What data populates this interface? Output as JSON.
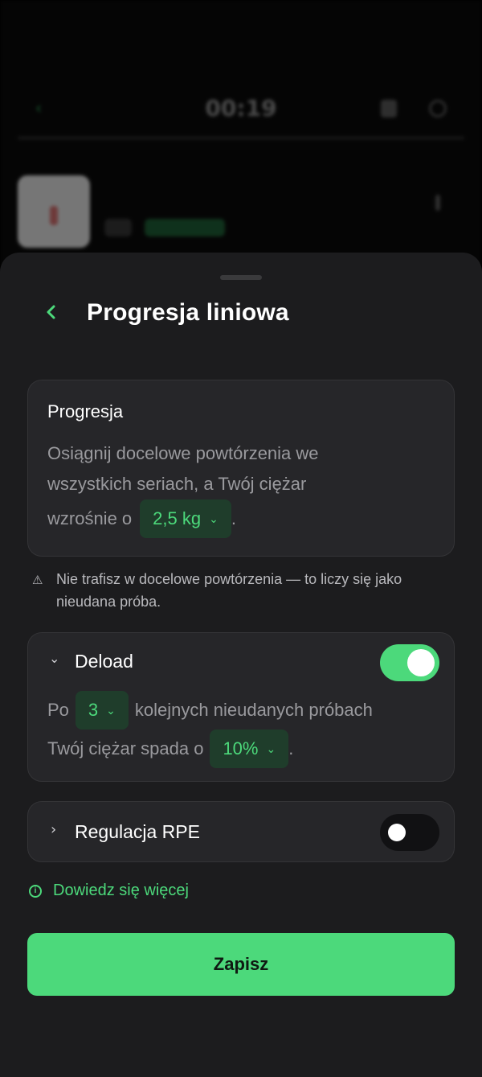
{
  "background": {
    "timer": "00:19"
  },
  "sheet": {
    "back_icon": "chevron-left-icon",
    "title": "Progresja liniowa"
  },
  "progression": {
    "title": "Progresja",
    "line1": "Osiągnij docelowe powtórzenia we",
    "line2": "wszystkich seriach, a Twój ciężar",
    "line3_prefix": "wzrośnie o",
    "increment": "2,5 kg",
    "line3_suffix": "."
  },
  "warning": {
    "icon": "warning-triangle-icon",
    "text": "Nie trafisz w docelowe powtórzenia — to liczy się jako nieudana próba."
  },
  "deload": {
    "title": "Deload",
    "enabled": true,
    "prefix": "Po",
    "attempts": "3",
    "middle": "kolejnych nieudanych próbach",
    "line2_prefix": "Twój ciężar spada o",
    "percent": "10%",
    "line2_suffix": "."
  },
  "rpe": {
    "title": "Regulacja RPE",
    "enabled": false
  },
  "learn_more": {
    "icon": "info-icon",
    "label": "Dowiedz się więcej"
  },
  "save_label": "Zapisz",
  "colors": {
    "accent": "#4cd97b",
    "sheet_bg": "#1c1c1e",
    "card_bg": "#262629"
  }
}
